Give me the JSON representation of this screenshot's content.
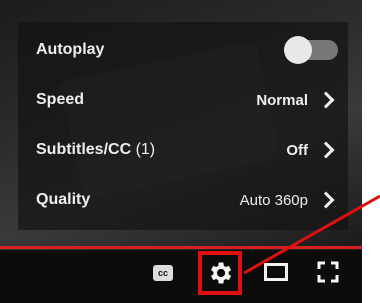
{
  "menu": {
    "items": [
      {
        "label": "Autoplay",
        "type": "toggle",
        "on": false
      },
      {
        "label": "Speed",
        "value": "Normal"
      },
      {
        "label": "Subtitles/CC",
        "extra": " (1)",
        "value": "Off"
      },
      {
        "label": "Quality",
        "value": "Auto 360p"
      }
    ]
  },
  "controls": {
    "cc_label": "cc",
    "icons": [
      "cc-icon",
      "gear-icon",
      "theater-icon",
      "fullscreen-icon"
    ]
  },
  "colors": {
    "progress": "#d62020",
    "highlight_box": "#e01010"
  }
}
